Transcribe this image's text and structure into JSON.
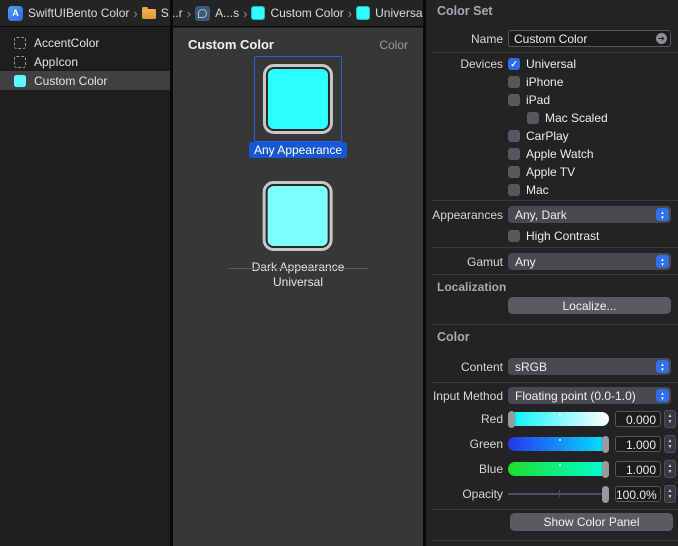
{
  "breadcrumb": {
    "items": [
      {
        "label": "SwiftUIBento Color",
        "icon": "xcode-project-icon"
      },
      {
        "label": "S...r",
        "icon": "folder-icon"
      },
      {
        "label": "A...s",
        "icon": "asset-catalog-icon"
      },
      {
        "label": "Custom Color",
        "icon": "color-swatch-icon"
      },
      {
        "label": "Universal",
        "icon": "color-swatch-icon"
      }
    ],
    "separator": "›"
  },
  "sidebar": {
    "items": [
      {
        "label": "AccentColor",
        "selected": false
      },
      {
        "label": "AppIcon",
        "selected": false
      },
      {
        "label": "Custom Color",
        "selected": true
      }
    ]
  },
  "canvas": {
    "title": "Custom Color",
    "type_label": "Color",
    "variants": [
      {
        "label": "Any Appearance",
        "color": "#2bffff",
        "selected": true
      },
      {
        "label": "Dark Appearance",
        "color": "#7cffff",
        "selected": false
      }
    ],
    "idiom_label": "Universal"
  },
  "inspector": {
    "color_set": {
      "header": "Color Set",
      "name_label": "Name",
      "name_value": "Custom Color",
      "devices_label": "Devices",
      "devices": [
        {
          "label": "Universal",
          "checked": true
        },
        {
          "label": "iPhone",
          "checked": false
        },
        {
          "label": "iPad",
          "checked": false
        },
        {
          "label": "Mac Scaled",
          "checked": false
        },
        {
          "label": "CarPlay",
          "checked": false
        },
        {
          "label": "Apple Watch",
          "checked": false
        },
        {
          "label": "Apple TV",
          "checked": false
        },
        {
          "label": "Mac",
          "checked": false
        }
      ],
      "appearances_label": "Appearances",
      "appearances_value": "Any, Dark",
      "high_contrast": {
        "label": "High Contrast",
        "checked": false
      },
      "gamut_label": "Gamut",
      "gamut_value": "Any",
      "localization_label": "Localization",
      "localize_button": "Localize..."
    },
    "color": {
      "header": "Color",
      "content_label": "Content",
      "content_value": "sRGB",
      "input_method_label": "Input Method",
      "input_method_value": "Floating point (0.0-1.0)",
      "sliders": [
        {
          "label": "Red",
          "value": "0.000",
          "position": 0,
          "gradient": [
            "#00f2ff",
            "#ffffff"
          ]
        },
        {
          "label": "Green",
          "value": "1.000",
          "position": 1,
          "gradient": [
            "#2734ec",
            "#00e9ff"
          ]
        },
        {
          "label": "Blue",
          "value": "1.000",
          "position": 1,
          "gradient": [
            "#1edd2e",
            "#00ffd9"
          ]
        },
        {
          "label": "Opacity",
          "value": "100.0%",
          "position": 1,
          "gradient": null
        }
      ],
      "show_color_panel_button": "Show Color Panel"
    }
  },
  "colors": {
    "selection_blue": "#1458d6",
    "checkbox_blue": "#2e6be5",
    "panel_bg": "#232325",
    "canvas_bg": "#373738",
    "sidebar_bg": "#1e1e1f"
  }
}
